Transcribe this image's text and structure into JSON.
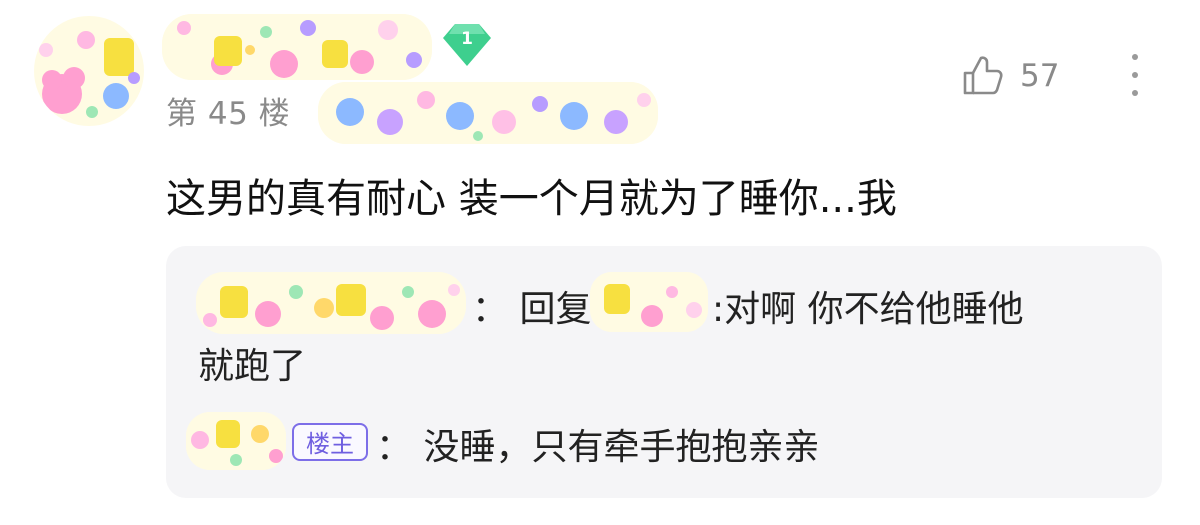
{
  "post": {
    "level": "1",
    "floor": "第 45 楼",
    "likes": "57",
    "comment": "这男的真有耐心 装一个月就为了睡你...我"
  },
  "replies": [
    {
      "prefix": "：  回复",
      "text": ":对啊 你不给他睡他",
      "text_cont": "就跑了"
    },
    {
      "badge": "楼主",
      "text": "：  没睡，只有牵手抱抱亲亲"
    }
  ],
  "icons": {
    "like": "thumbs-up-icon",
    "more": "more-vertical-icon",
    "level": "gem-level-badge-icon"
  },
  "colors": {
    "accent_badge": "#7d6ee8",
    "level_gem": "#3ecf8e",
    "muted_text": "#8a8a8a",
    "reply_bg": "#f5f5f7"
  }
}
